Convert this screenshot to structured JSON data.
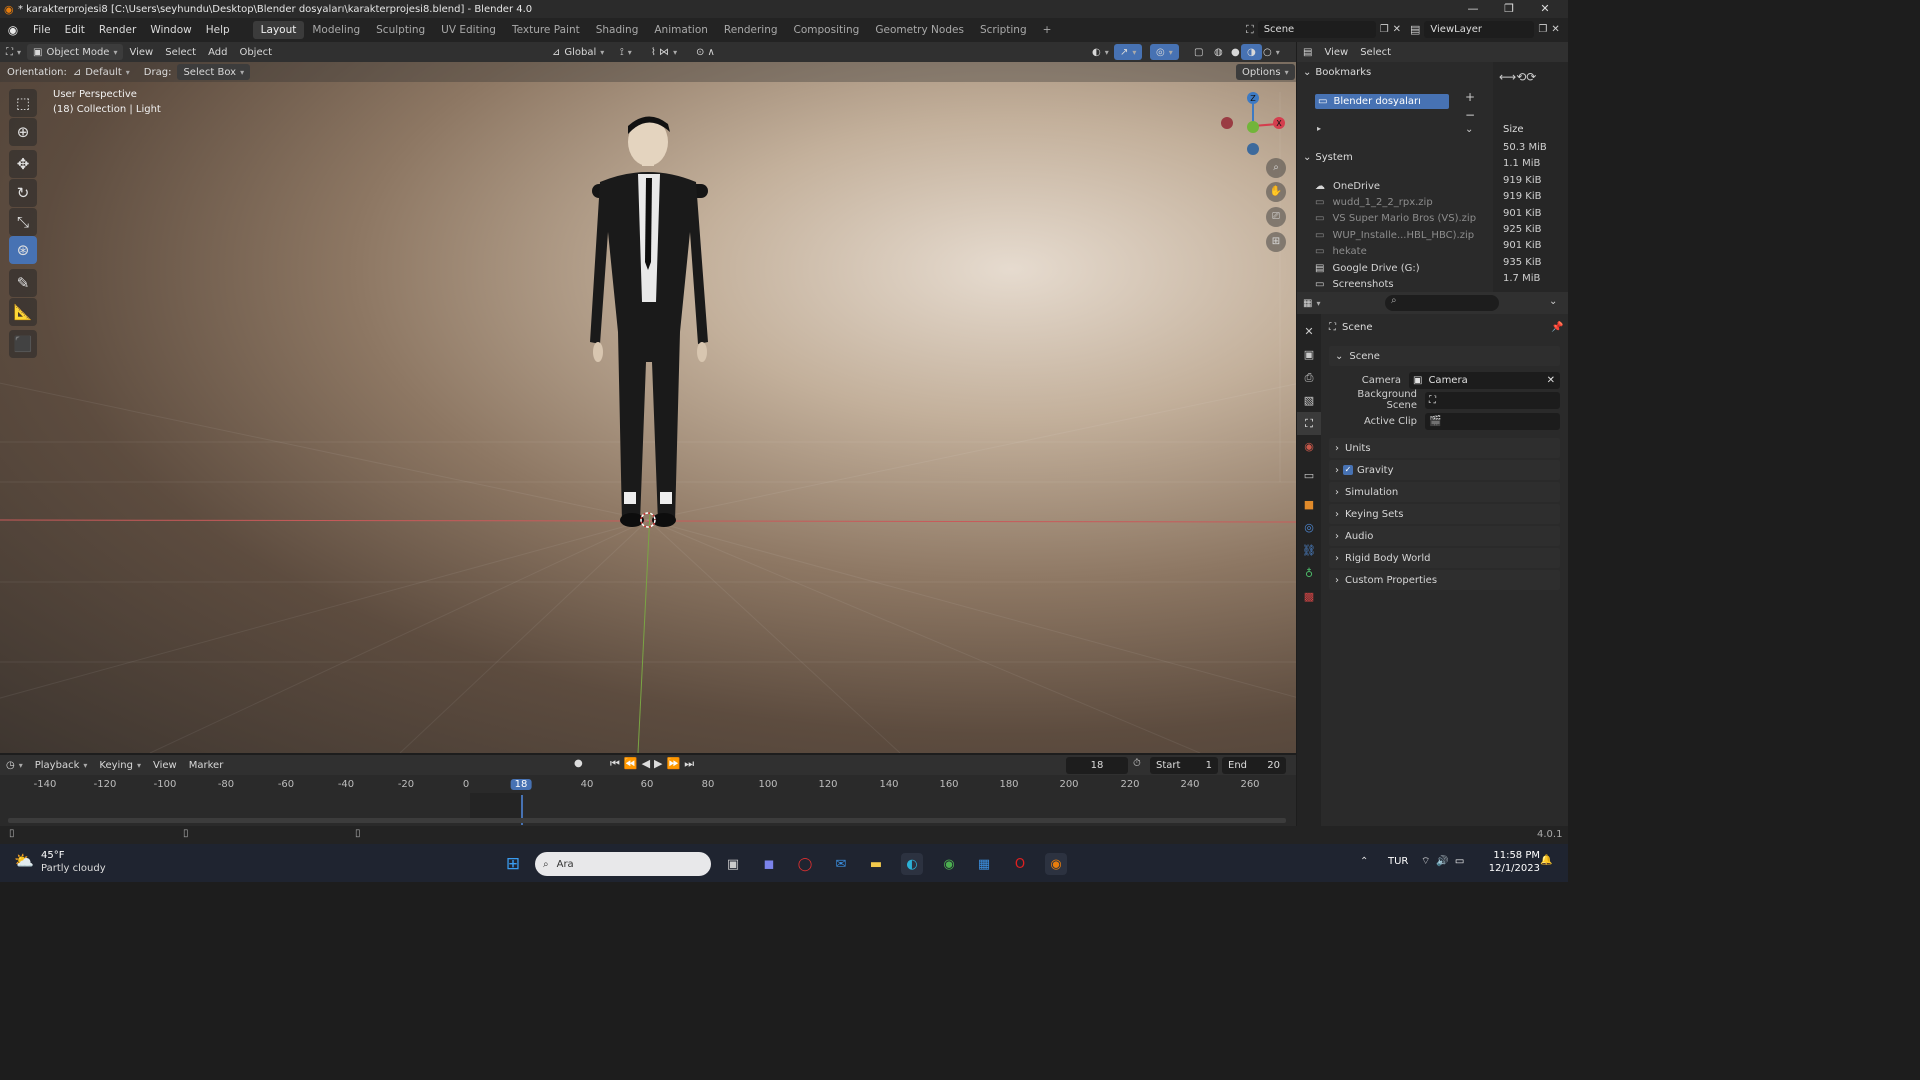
{
  "title": "* karakterprojesi8 [C:\\Users\\seyhundu\\Desktop\\Blender dosyaları\\karakterprojesi8.blend] - Blender 4.0",
  "menu": [
    "File",
    "Edit",
    "Render",
    "Window",
    "Help"
  ],
  "workspaces": [
    "Layout",
    "Modeling",
    "Sculpting",
    "UV Editing",
    "Texture Paint",
    "Shading",
    "Animation",
    "Rendering",
    "Compositing",
    "Geometry Nodes",
    "Scripting"
  ],
  "scene_field": "Scene",
  "viewlayer_field": "ViewLayer",
  "viewport_header": {
    "mode": "Object Mode",
    "view": "View",
    "select": "Select",
    "add": "Add",
    "object": "Object",
    "transform": "Global",
    "orientation_label": "Orientation:",
    "orientation_value": "Default",
    "drag_label": "Drag:",
    "drag_value": "Select Box",
    "options": "Options"
  },
  "viewport_info": {
    "line1": "User Perspective",
    "line2": "(18) Collection | Light"
  },
  "outliner": {
    "view": "View",
    "select": "Select",
    "bookmarks_title": "Bookmarks",
    "bookmark_item": "Blender dosyaları",
    "system_title": "System",
    "system_items": [
      "OneDrive",
      "wudd_1_2_2_rpx.zip",
      "VS Super Mario Bros (VS).zip",
      "WUP_Installe...HBL_HBC).zip",
      "hekate",
      "Google Drive (G:)",
      "Screenshots"
    ],
    "size_header": "Size",
    "sizes": [
      "50.3 MiB",
      "1.1 MiB",
      "919 KiB",
      "919 KiB",
      "901 KiB",
      "925 KiB",
      "901 KiB",
      "935 KiB",
      "1.7 MiB"
    ]
  },
  "properties": {
    "scene_title": "Scene",
    "section_scene": "Scene",
    "camera_label": "Camera",
    "camera_value": "Camera",
    "bg_scene_label": "Background Scene",
    "active_clip_label": "Active Clip",
    "sections": [
      "Units",
      "Gravity",
      "Simulation",
      "Keying Sets",
      "Audio",
      "Rigid Body World",
      "Custom Properties"
    ]
  },
  "timeline": {
    "playback": "Playback",
    "keying": "Keying",
    "view": "View",
    "marker": "Marker",
    "current_frame": "18",
    "start_label": "Start",
    "start_value": "1",
    "end_label": "End",
    "end_value": "20",
    "ticks": [
      "-140",
      "-120",
      "-100",
      "-80",
      "-60",
      "-40",
      "-20",
      "0",
      "18",
      "40",
      "60",
      "80",
      "100",
      "120",
      "140",
      "160",
      "180",
      "200",
      "220",
      "240",
      "260"
    ]
  },
  "status": {
    "version": "4.0.1"
  },
  "taskbar": {
    "weather_temp": "45°F",
    "weather_desc": "Partly cloudy",
    "search_placeholder": "Ara",
    "lang": "TUR",
    "time": "11:58 PM",
    "date": "12/1/2023"
  },
  "colors": {
    "accent": "#4772b3",
    "x_axis": "#d43e4e",
    "y_axis": "#72b53a",
    "z_axis": "#3d7ac3"
  }
}
